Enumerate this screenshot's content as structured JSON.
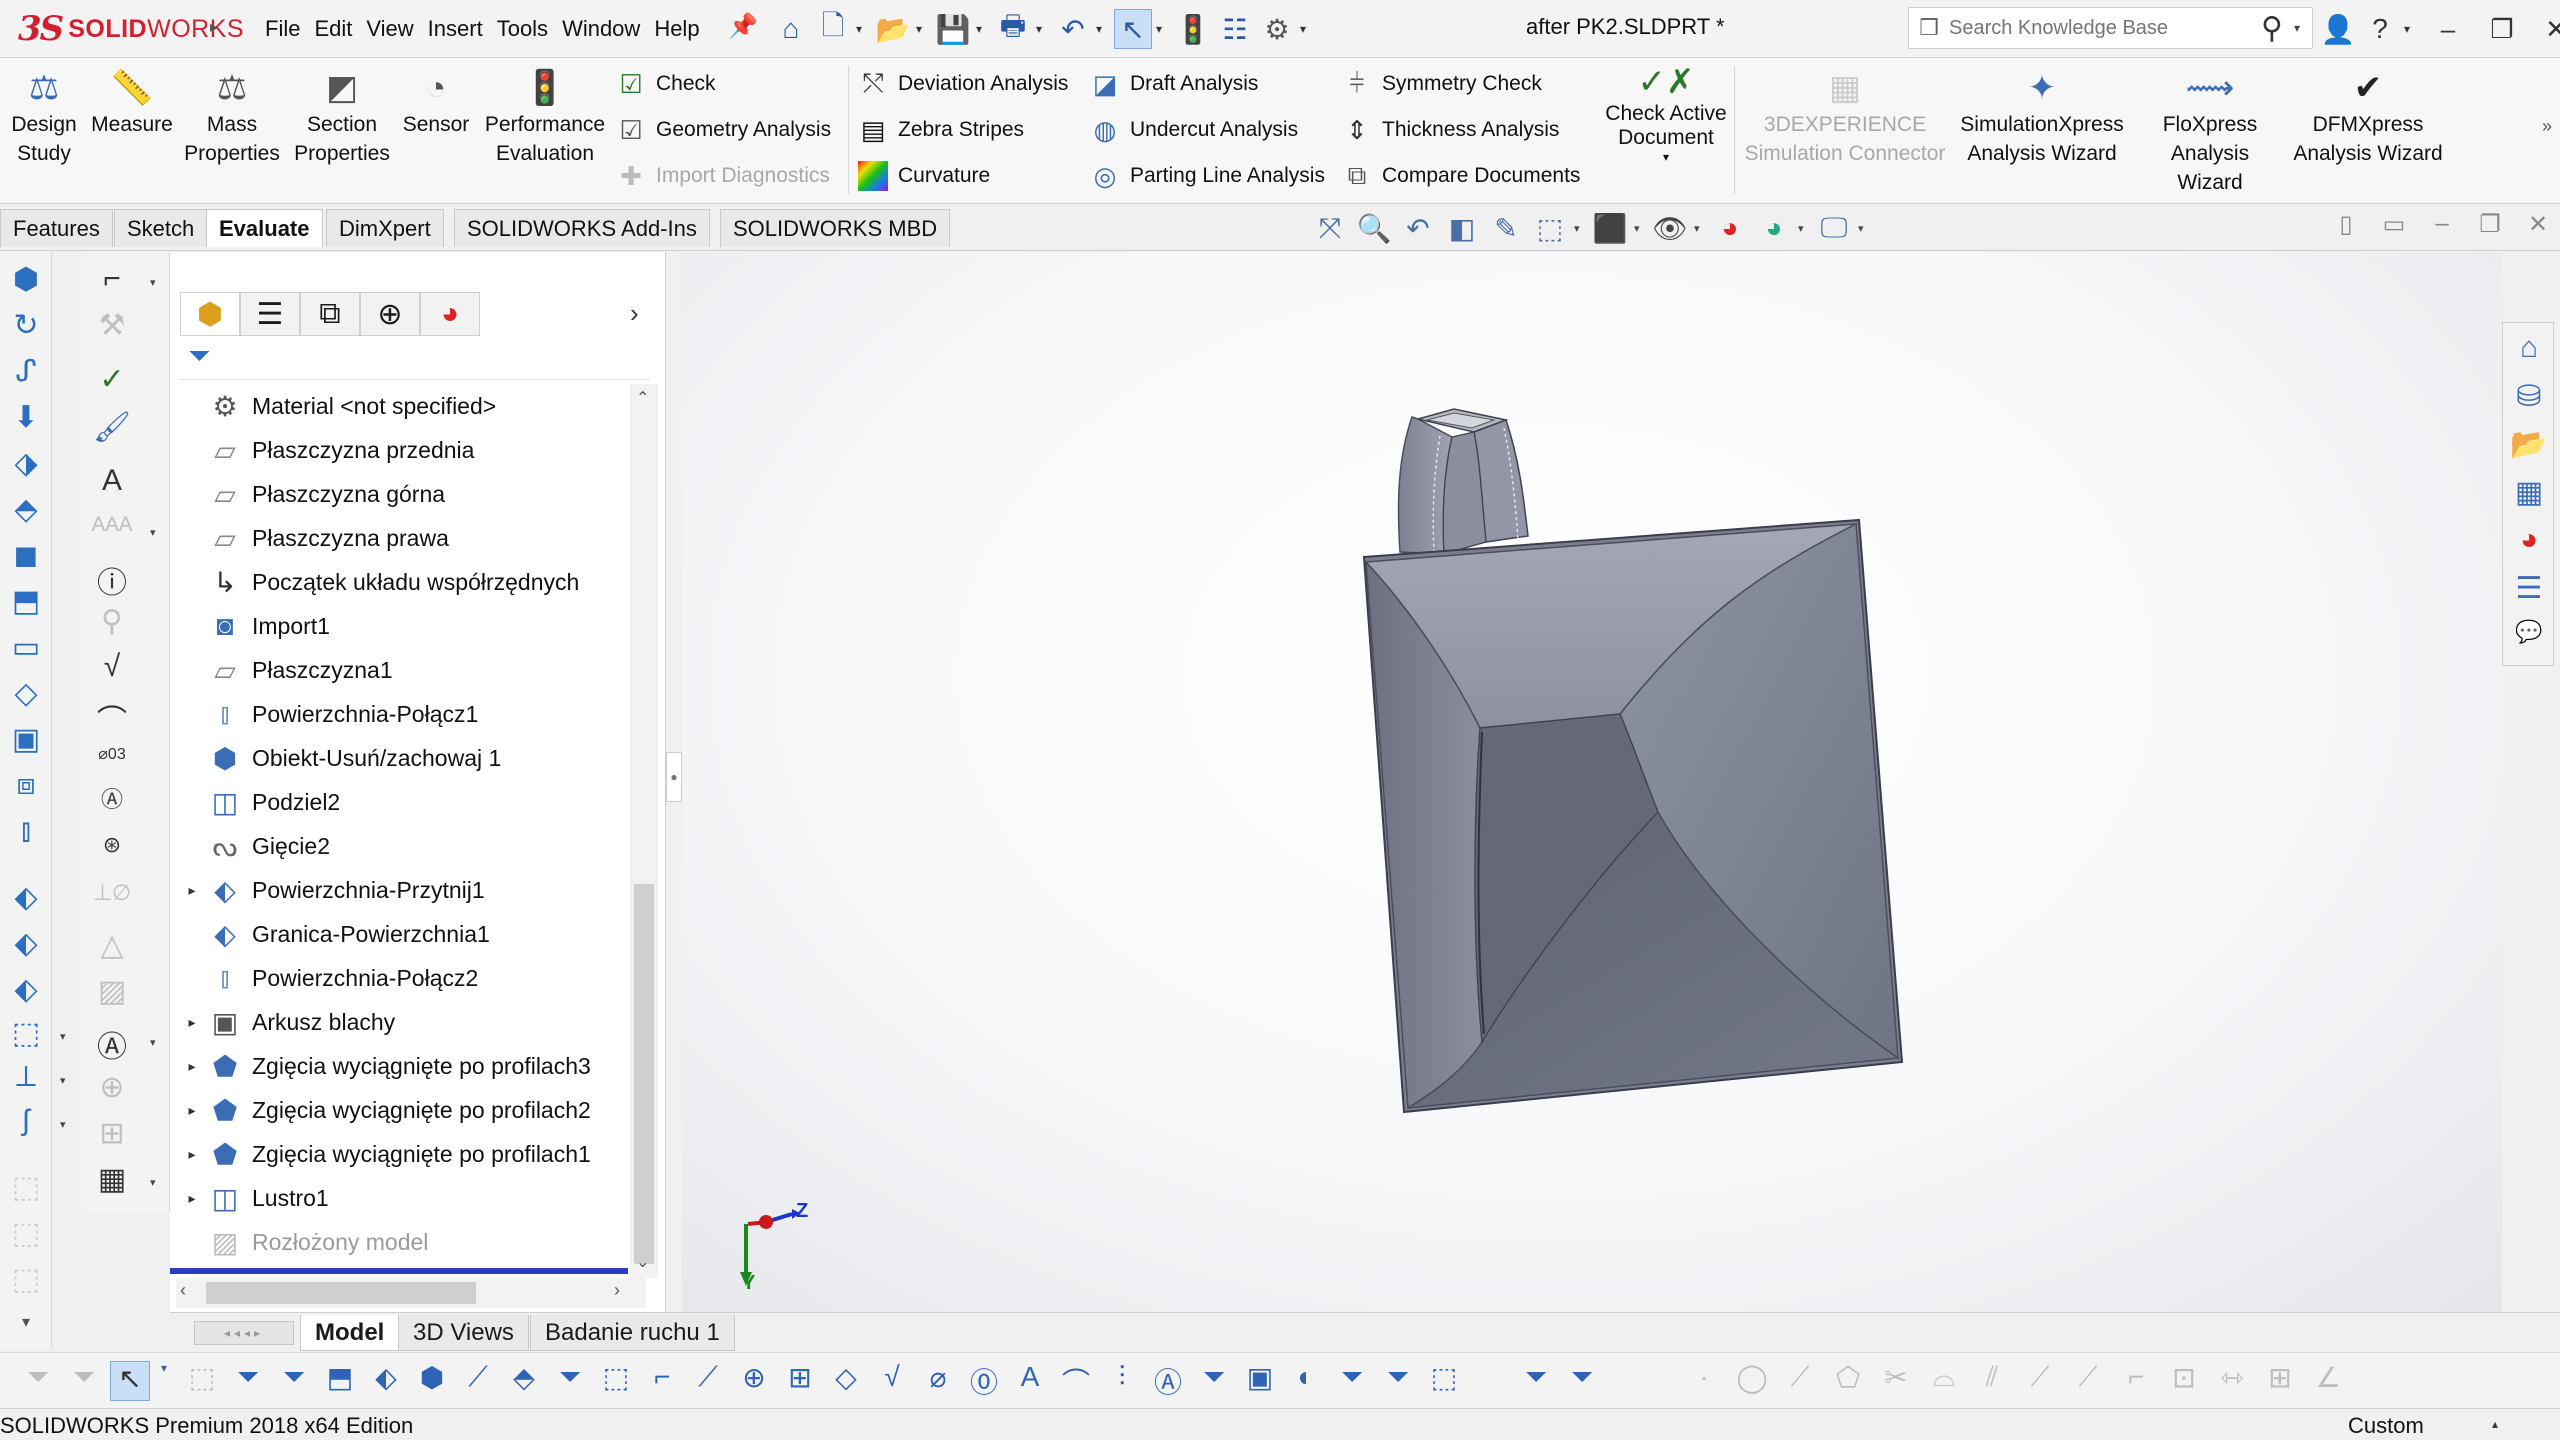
{
  "app": {
    "brand_mark": "3S",
    "brand_bold": "SOLID",
    "brand_light": "WORKS",
    "document_title": "after PK2.SLDPRT *"
  },
  "menu": [
    "File",
    "Edit",
    "View",
    "Insert",
    "Tools",
    "Window",
    "Help"
  ],
  "search": {
    "placeholder": "Search Knowledge Base"
  },
  "ribbon": {
    "design_study": "Design Study",
    "measure": "Measure",
    "mass_properties": "Mass Properties",
    "section_properties": "Section Properties",
    "sensor": "Sensor",
    "performance_evaluation": "Performance Evaluation",
    "check": "Check",
    "geometry_analysis": "Geometry Analysis",
    "import_diagnostics": "Import Diagnostics",
    "deviation_analysis": "Deviation Analysis",
    "zebra_stripes": "Zebra Stripes",
    "curvature": "Curvature",
    "draft_analysis": "Draft Analysis",
    "undercut_analysis": "Undercut Analysis",
    "parting_line_analysis": "Parting Line Analysis",
    "symmetry_check": "Symmetry Check",
    "thickness_analysis": "Thickness Analysis",
    "compare_documents": "Compare Documents",
    "check_active_document": "Check Active Document",
    "experience_connector": "3DEXPERIENCE Simulation Connector",
    "simulationxpress": "SimulationXpress Analysis Wizard",
    "floxpress": "FloXpress Analysis Wizard",
    "dfmxpress": "DFMXpress Analysis Wizard"
  },
  "command_tabs": [
    "Features",
    "Sketch",
    "Evaluate",
    "DimXpert",
    "SOLIDWORKS Add-Ins",
    "SOLIDWORKS MBD"
  ],
  "active_command_tab": "Evaluate",
  "feature_tree": [
    {
      "label": "Material <not specified>",
      "icon": "material-icon",
      "expandable": false
    },
    {
      "label": "Płaszczyzna przednia",
      "icon": "plane-icon",
      "expandable": false
    },
    {
      "label": "Płaszczyzna górna",
      "icon": "plane-icon",
      "expandable": false
    },
    {
      "label": "Płaszczyzna prawa",
      "icon": "plane-icon",
      "expandable": false
    },
    {
      "label": "Początek układu współrzędnych",
      "icon": "origin-icon",
      "expandable": false
    },
    {
      "label": "Import1",
      "icon": "import-icon",
      "expandable": false
    },
    {
      "label": "Płaszczyzna1",
      "icon": "plane-icon",
      "expandable": false
    },
    {
      "label": "Powierzchnia-Połącz1",
      "icon": "surface-knit-icon",
      "expandable": false
    },
    {
      "label": "Obiekt-Usuń/zachowaj 1",
      "icon": "delete-body-icon",
      "expandable": false
    },
    {
      "label": "Podziel2",
      "icon": "split-icon",
      "expandable": false
    },
    {
      "label": "Gięcie2",
      "icon": "flex-icon",
      "expandable": false
    },
    {
      "label": "Powierzchnia-Przytnij1",
      "icon": "surface-trim-icon",
      "expandable": true
    },
    {
      "label": "Granica-Powierzchnia1",
      "icon": "boundary-surface-icon",
      "expandable": false
    },
    {
      "label": "Powierzchnia-Połącz2",
      "icon": "surface-knit-icon",
      "expandable": false
    },
    {
      "label": "Arkusz blachy",
      "icon": "sheet-metal-icon",
      "expandable": true
    },
    {
      "label": "Zgięcia wyciągnięte po profilach3",
      "icon": "lofted-bend-icon",
      "expandable": true
    },
    {
      "label": "Zgięcia wyciągnięte po profilach2",
      "icon": "lofted-bend-icon",
      "expandable": true
    },
    {
      "label": "Zgięcia wyciągnięte po profilach1",
      "icon": "lofted-bend-icon",
      "expandable": true
    },
    {
      "label": "Lustro1",
      "icon": "mirror-icon",
      "expandable": true
    },
    {
      "label": "Rozłożony model",
      "icon": "flat-pattern-icon",
      "expandable": false,
      "suppressed": true
    }
  ],
  "bottom_tabs": [
    "Model",
    "3D Views",
    "Badanie ruchu 1"
  ],
  "active_bottom_tab": "Model",
  "triad": {
    "z": "Z",
    "y": "Y"
  },
  "status": {
    "edition": "SOLIDWORKS Premium 2018 x64 Edition",
    "units": "Custom"
  },
  "colors": {
    "brand_red": "#d2202f",
    "model_gray": "#8a8e9a",
    "rollback_bar": "#2b3cc6",
    "selection_blue": "#c9dff6"
  }
}
